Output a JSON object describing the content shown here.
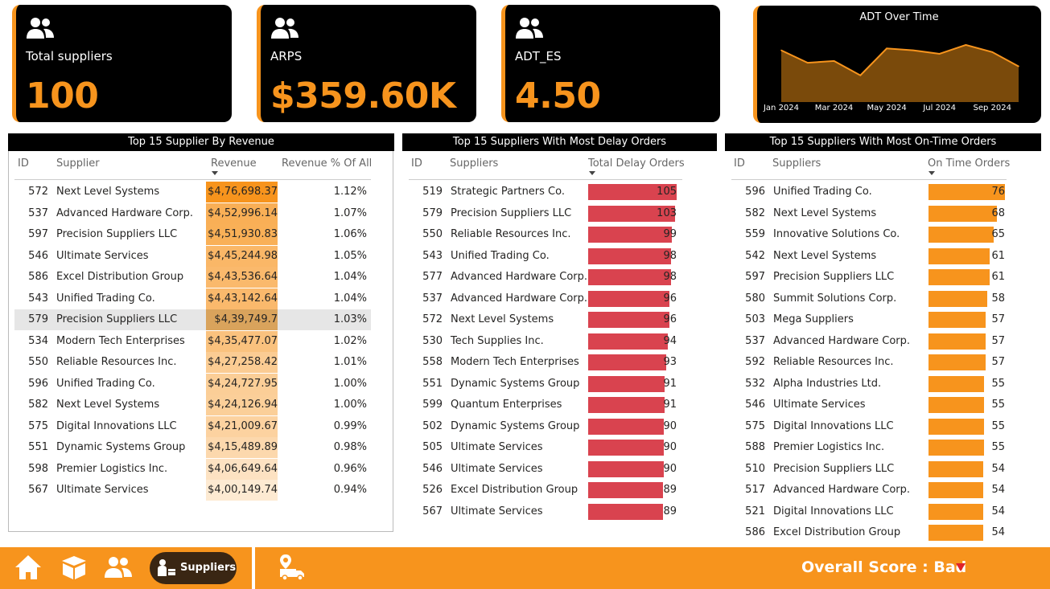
{
  "kpis": [
    {
      "label": "Total suppliers",
      "value": "100",
      "icon": "users-icon"
    },
    {
      "label": "ARPS",
      "value": "$359.60K",
      "icon": "users-icon"
    },
    {
      "label": "ADT_ES",
      "value": "4.50",
      "icon": "users-icon"
    }
  ],
  "adt_chart": {
    "title": "ADT Over Time",
    "chart_data": {
      "type": "area",
      "title": "ADT Over Time",
      "x": [
        "Jan 2024",
        "Feb 2024",
        "Mar 2024",
        "Apr 2024",
        "May 2024",
        "Jun 2024",
        "Jul 2024",
        "Aug 2024",
        "Sep 2024",
        "Oct 2024"
      ],
      "tick_labels": [
        "Jan 2024",
        "Mar 2024",
        "May 2024",
        "Jul 2024",
        "Sep 2024"
      ],
      "values": [
        4.9,
        4.2,
        4.3,
        3.5,
        5.0,
        4.9,
        4.7,
        5.2,
        4.8,
        4.0
      ],
      "ylim": [
        2.0,
        5.6
      ],
      "color": "#F7941D",
      "fill": "#7A4A0B"
    }
  },
  "revenue_table": {
    "title": "Top 15 Supplier By Revenue",
    "headers": {
      "id": "ID",
      "supplier": "Supplier",
      "revenue": "Revenue",
      "pct": "Revenue % Of All"
    },
    "rows": [
      {
        "id": "572",
        "supplier": "Next Level Systems",
        "revenue": "$4,76,698.37",
        "pct": "1.12%"
      },
      {
        "id": "537",
        "supplier": "Advanced Hardware Corp.",
        "revenue": "$4,52,996.14",
        "pct": "1.07%"
      },
      {
        "id": "597",
        "supplier": "Precision Suppliers LLC",
        "revenue": "$4,51,930.83",
        "pct": "1.06%"
      },
      {
        "id": "546",
        "supplier": "Ultimate Services",
        "revenue": "$4,45,244.98",
        "pct": "1.05%"
      },
      {
        "id": "586",
        "supplier": "Excel Distribution Group",
        "revenue": "$4,43,536.64",
        "pct": "1.04%"
      },
      {
        "id": "543",
        "supplier": "Unified Trading Co.",
        "revenue": "$4,43,142.64",
        "pct": "1.04%"
      },
      {
        "id": "579",
        "supplier": "Precision Suppliers LLC",
        "revenue": "$4,39,749.7",
        "pct": "1.03%"
      },
      {
        "id": "534",
        "supplier": "Modern Tech Enterprises",
        "revenue": "$4,35,477.07",
        "pct": "1.02%"
      },
      {
        "id": "550",
        "supplier": "Reliable Resources Inc.",
        "revenue": "$4,27,258.42",
        "pct": "1.01%"
      },
      {
        "id": "596",
        "supplier": "Unified Trading Co.",
        "revenue": "$4,24,727.95",
        "pct": "1.00%"
      },
      {
        "id": "582",
        "supplier": "Next Level Systems",
        "revenue": "$4,24,126.94",
        "pct": "1.00%"
      },
      {
        "id": "575",
        "supplier": "Digital Innovations LLC",
        "revenue": "$4,21,009.67",
        "pct": "0.99%"
      },
      {
        "id": "551",
        "supplier": "Dynamic Systems Group",
        "revenue": "$4,15,489.89",
        "pct": "0.98%"
      },
      {
        "id": "598",
        "supplier": "Premier Logistics Inc.",
        "revenue": "$4,06,649.64",
        "pct": "0.96%"
      },
      {
        "id": "567",
        "supplier": "Ultimate Services",
        "revenue": "$4,00,149.74",
        "pct": "0.94%"
      }
    ]
  },
  "delay_table": {
    "title": "Top 15 Suppliers With Most Delay Orders",
    "headers": {
      "id": "ID",
      "supplier": "Suppliers",
      "value": "Total Delay Orders"
    },
    "bar_color": "#D9434F",
    "max": 105,
    "rows": [
      {
        "id": "519",
        "supplier": "Strategic Partners Co.",
        "value": 105
      },
      {
        "id": "579",
        "supplier": "Precision Suppliers LLC",
        "value": 103
      },
      {
        "id": "550",
        "supplier": "Reliable Resources Inc.",
        "value": 99
      },
      {
        "id": "543",
        "supplier": "Unified Trading Co.",
        "value": 98
      },
      {
        "id": "577",
        "supplier": "Advanced Hardware Corp.",
        "value": 98
      },
      {
        "id": "537",
        "supplier": "Advanced Hardware Corp.",
        "value": 96
      },
      {
        "id": "572",
        "supplier": "Next Level Systems",
        "value": 96
      },
      {
        "id": "530",
        "supplier": "Tech Supplies Inc.",
        "value": 94
      },
      {
        "id": "558",
        "supplier": "Modern Tech Enterprises",
        "value": 93
      },
      {
        "id": "551",
        "supplier": "Dynamic Systems Group",
        "value": 91
      },
      {
        "id": "599",
        "supplier": "Quantum Enterprises",
        "value": 91
      },
      {
        "id": "502",
        "supplier": "Dynamic Systems Group",
        "value": 90
      },
      {
        "id": "505",
        "supplier": "Ultimate Services",
        "value": 90
      },
      {
        "id": "546",
        "supplier": "Ultimate Services",
        "value": 90
      },
      {
        "id": "526",
        "supplier": "Excel Distribution Group",
        "value": 89
      },
      {
        "id": "567",
        "supplier": "Ultimate Services",
        "value": 89
      }
    ]
  },
  "ontime_table": {
    "title": "Top 15 Suppliers With Most On-Time Orders",
    "headers": {
      "id": "ID",
      "supplier": "Suppliers",
      "value": "On Time Orders"
    },
    "bar_color": "#F7941D",
    "max": 76,
    "rows": [
      {
        "id": "596",
        "supplier": "Unified Trading Co.",
        "value": 76
      },
      {
        "id": "582",
        "supplier": "Next Level Systems",
        "value": 68
      },
      {
        "id": "559",
        "supplier": "Innovative Solutions Co.",
        "value": 65
      },
      {
        "id": "542",
        "supplier": "Next Level Systems",
        "value": 61
      },
      {
        "id": "597",
        "supplier": "Precision Suppliers LLC",
        "value": 61
      },
      {
        "id": "580",
        "supplier": "Summit Solutions Corp.",
        "value": 58
      },
      {
        "id": "503",
        "supplier": "Mega Suppliers",
        "value": 57
      },
      {
        "id": "537",
        "supplier": "Advanced Hardware Corp.",
        "value": 57
      },
      {
        "id": "592",
        "supplier": "Reliable Resources Inc.",
        "value": 57
      },
      {
        "id": "532",
        "supplier": "Alpha Industries Ltd.",
        "value": 55
      },
      {
        "id": "546",
        "supplier": "Ultimate Services",
        "value": 55
      },
      {
        "id": "575",
        "supplier": "Digital Innovations LLC",
        "value": 55
      },
      {
        "id": "588",
        "supplier": "Premier Logistics Inc.",
        "value": 55
      },
      {
        "id": "510",
        "supplier": "Precision Suppliers LLC",
        "value": 54
      },
      {
        "id": "517",
        "supplier": "Advanced Hardware Corp.",
        "value": 54
      },
      {
        "id": "521",
        "supplier": "Digital Innovations LLC",
        "value": 54
      },
      {
        "id": "586",
        "supplier": "Excel Distribution Group",
        "value": 54
      }
    ]
  },
  "footer": {
    "nav": [
      "home-icon",
      "box-icon",
      "users-icon",
      "delivery-truck-icon"
    ],
    "active_button_label": "Suppliers",
    "overall_score": "Overall Score : Bad"
  },
  "colors": {
    "accent": "#F7941D",
    "kpi_bg": "#000000",
    "delay_bar": "#D9434F",
    "score_arrow": "#E0242B"
  }
}
